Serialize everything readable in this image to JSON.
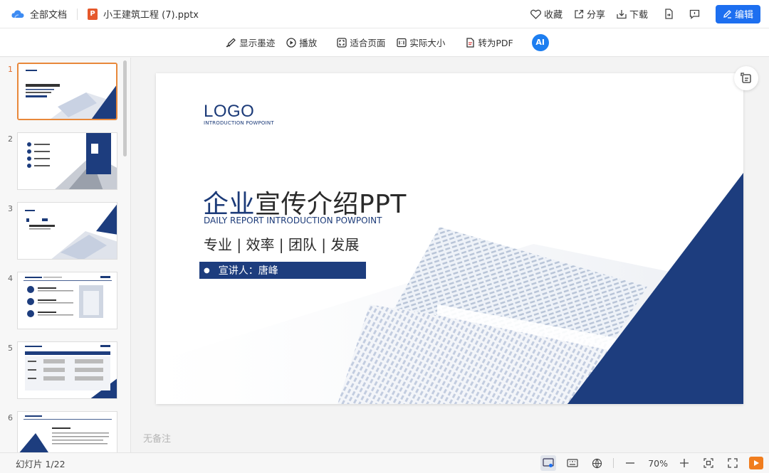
{
  "header": {
    "all_docs": "全部文档",
    "file_name": "小王建筑工程 (7).pptx",
    "favorite": "收藏",
    "share": "分享",
    "download": "下载",
    "edit": "编辑"
  },
  "toolbar": {
    "show_ink": "显示墨迹",
    "play": "播放",
    "fit_page": "适合页面",
    "actual_size": "实际大小",
    "to_pdf": "转为PDF",
    "ai_label": "AI"
  },
  "slide": {
    "logo": "LOGO",
    "logo_sub": "INTRODUCTION POWPOINT",
    "title_blue": "企业",
    "title_rest": "宣传介绍PPT",
    "subtitle": "DAILY REPORT INTRODUCTION POWPOINT",
    "tags": "专业 | 效率 | 团队 | 发展",
    "presenter": "宣讲人：唐峰"
  },
  "thumbnails": [
    {
      "num": "1"
    },
    {
      "num": "2"
    },
    {
      "num": "3"
    },
    {
      "num": "4"
    },
    {
      "num": "5"
    },
    {
      "num": "6"
    }
  ],
  "notes_placeholder": "无备注",
  "status": {
    "slide_counter": "幻灯片 1/22",
    "zoom": "70%"
  },
  "colors": {
    "accent": "#1d6ff0",
    "slide_blue": "#1b3a78",
    "active_thumb": "#e8883a"
  }
}
